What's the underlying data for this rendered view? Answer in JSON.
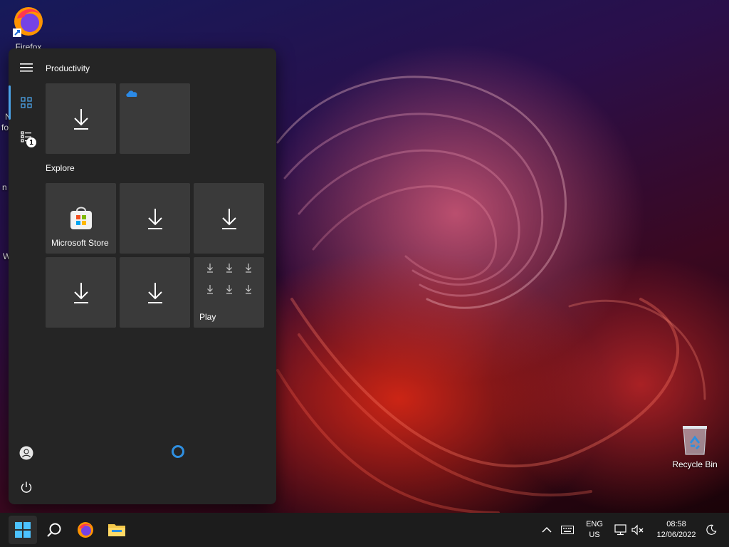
{
  "desktop": {
    "icons": [
      {
        "label": "Firefox"
      },
      {
        "label": "Recycle Bin"
      }
    ],
    "partial_labels": [
      "N",
      "fo",
      "n",
      "W"
    ]
  },
  "start_menu": {
    "groups": [
      {
        "title": "Productivity"
      },
      {
        "title": "Explore"
      }
    ],
    "tiles": {
      "microsoft_store": "Microsoft Store",
      "play": "Play"
    },
    "nav_badge": "1"
  },
  "taskbar": {
    "language": {
      "line1": "ENG",
      "line2": "US"
    },
    "clock": {
      "time": "08:58",
      "date": "12/06/2022"
    }
  },
  "colors": {
    "accent": "#4ba3e8",
    "menu_bg": "#252525",
    "tile_bg": "#3a3a3a",
    "taskbar_bg": "#1c1c1c"
  }
}
